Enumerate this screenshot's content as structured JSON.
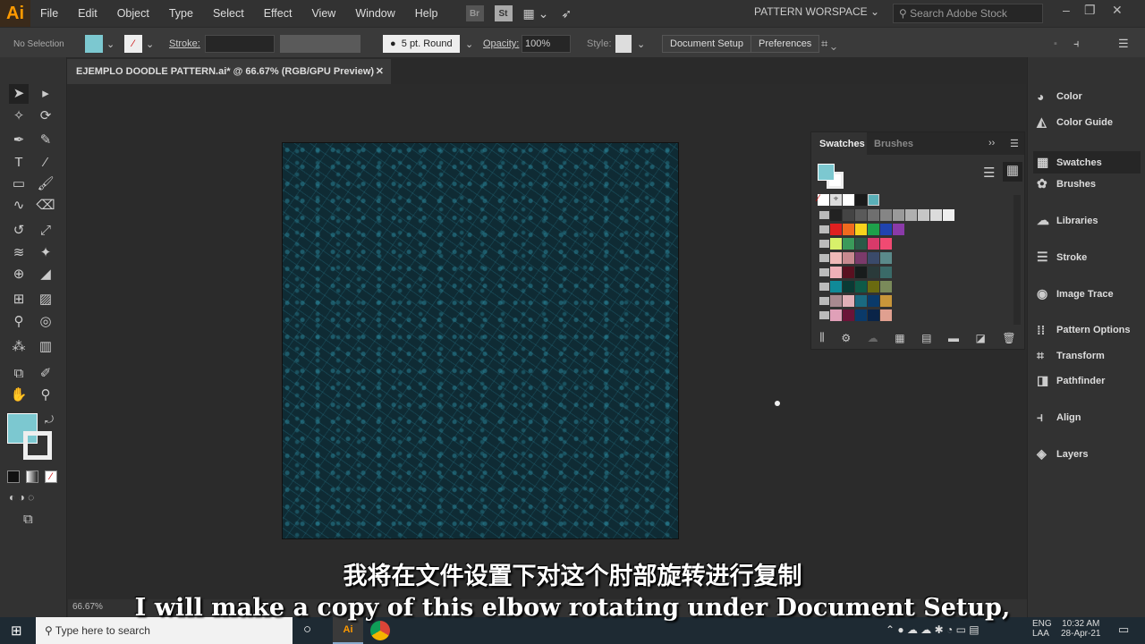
{
  "app": {
    "logo": "Ai",
    "menus": [
      "File",
      "Edit",
      "Object",
      "Type",
      "Select",
      "Effect",
      "View",
      "Window",
      "Help"
    ],
    "bridge": "Br",
    "stock": "St",
    "workspace": "PATTERN WORSPACE",
    "search_placeholder": "Search Adobe Stock"
  },
  "control": {
    "selection": "No Selection",
    "stroke_label": "Stroke:",
    "brush": "5 pt. Round",
    "opacity_label": "Opacity:",
    "opacity": "100%",
    "style_label": "Style:",
    "document_setup": "Document Setup",
    "preferences": "Preferences"
  },
  "document": {
    "tab_title": "EJEMPLO DOODLE PATTERN.ai* @ 66.67% (RGB/GPU Preview)",
    "zoom": "66.67%"
  },
  "swatches": {
    "tabs": [
      "Swatches",
      "Brushes"
    ],
    "rows": [
      [
        "#222222",
        "#444444",
        "#5a5a5a",
        "#6f6f6f",
        "#858585",
        "#9a9a9a",
        "#b0b0b0",
        "#c6c6c6",
        "#dcdcdc",
        "#efefef"
      ],
      [
        "#e02020",
        "#f06a1e",
        "#f8d21c",
        "#1ea04a",
        "#2044b0",
        "#8a3aa8"
      ],
      [
        "#d8f06a",
        "#3a9a5a",
        "#2a5a48",
        "#d83a6a",
        "#f04a72"
      ],
      [
        "#f0b8b8",
        "#c88a90",
        "#7a3a6a",
        "#3a4a6a",
        "#5a8a8a"
      ],
      [
        "#f0b0b8",
        "#5a1020",
        "#181c1c",
        "#2a3a3a",
        "#3a6a68"
      ],
      [
        "#108a98",
        "#0a3a34",
        "#0e5a48",
        "#6a6a10",
        "#7a8a5a"
      ],
      [
        "#a88a90",
        "#e0b0b8",
        "#1a6a80",
        "#0a3a6a",
        "#c8963a"
      ],
      [
        "#e0a0b8",
        "#6a1438",
        "#0a3a6a",
        "#0a2448",
        "#e0a090"
      ]
    ]
  },
  "panels": [
    {
      "label": "Color",
      "icon": "color-icon"
    },
    {
      "label": "Color Guide",
      "icon": "color-guide-icon"
    },
    {
      "label": "Swatches",
      "icon": "swatches-icon"
    },
    {
      "label": "Brushes",
      "icon": "brushes-icon"
    },
    {
      "label": "Libraries",
      "icon": "libraries-icon"
    },
    {
      "label": "Stroke",
      "icon": "stroke-icon"
    },
    {
      "label": "Image Trace",
      "icon": "image-trace-icon"
    },
    {
      "label": "Pattern Options",
      "icon": "pattern-options-icon"
    },
    {
      "label": "Transform",
      "icon": "transform-icon"
    },
    {
      "label": "Pathfinder",
      "icon": "pathfinder-icon"
    },
    {
      "label": "Align",
      "icon": "align-icon"
    },
    {
      "label": "Layers",
      "icon": "layers-icon"
    }
  ],
  "subtitles": {
    "zh": "我将在文件设置下对这个肘部旋转进行复制",
    "en": "I will make a copy of this elbow rotating under Document Setup,"
  },
  "taskbar": {
    "search_placeholder": "Type here to search",
    "lang1": "ENG",
    "lang2": "LAA",
    "time": "10:32 AM",
    "date": "28-Apr-21"
  },
  "colors": {
    "artboard": "#0f2b34",
    "pattern": "#2a8a9a",
    "accent": "#ff9a00"
  }
}
